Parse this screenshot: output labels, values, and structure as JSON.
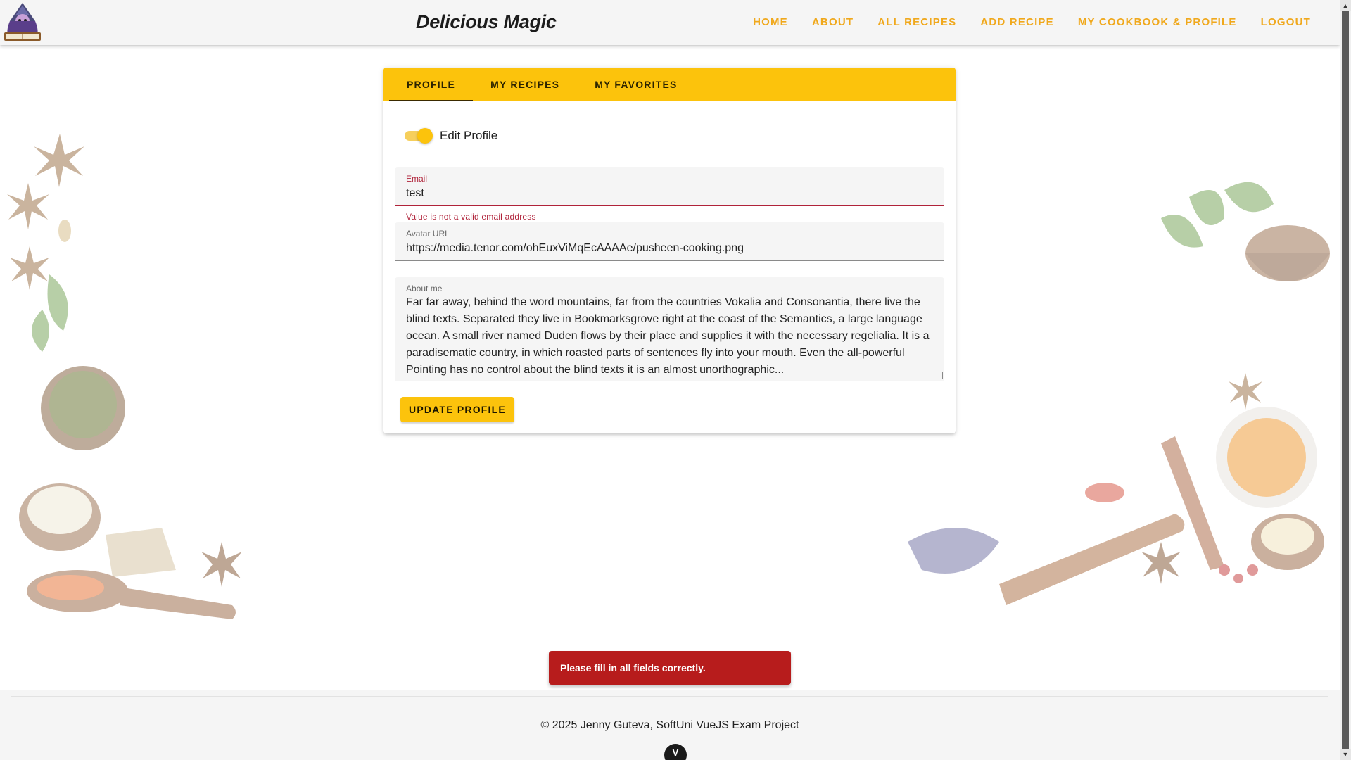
{
  "header": {
    "title": "Delicious Magic",
    "logo_icon": "wizard-cookbook-logo-icon",
    "nav": [
      {
        "label": "HOME"
      },
      {
        "label": "ABOUT"
      },
      {
        "label": "ALL RECIPES"
      },
      {
        "label": "ADD RECIPE"
      },
      {
        "label": "MY COOKBOOK & PROFILE"
      },
      {
        "label": "LOGOUT"
      }
    ],
    "nav_color": "#f0a81c"
  },
  "tabs": [
    {
      "label": "PROFILE",
      "active": true
    },
    {
      "label": "MY RECIPES",
      "active": false
    },
    {
      "label": "MY FAVORITES",
      "active": false
    }
  ],
  "accent_color": "#fcc30c",
  "profile": {
    "edit_toggle_label": "Edit Profile",
    "edit_toggle_on": true,
    "email": {
      "label": "Email",
      "value": "test",
      "error": "Value is not a valid email address"
    },
    "avatar": {
      "label": "Avatar URL",
      "value": "https://media.tenor.com/ohEuxViMqEcAAAAe/pusheen-cooking.png"
    },
    "about": {
      "label": "About me",
      "value": "Far far away, behind the word mountains, far from the countries Vokalia and Consonantia, there live the blind texts. Separated they live in Bookmarksgrove right at the coast of the Semantics, a large language ocean. A small river named Duden flows by their place and supplies it with the necessary regelialia. It is a paradisematic country, in which roasted parts of sentences fly into your mouth. Even the all-powerful Pointing has no control about the blind texts it is an almost unorthographic..."
    },
    "update_button": "UPDATE PROFILE"
  },
  "snackbar": {
    "message": "Please fill in all fields correctly.",
    "color": "#b71c1c"
  },
  "footer": {
    "text": "© 2025 Jenny Guteva, SoftUni VueJS Exam Project",
    "icon": "vue-devtools-icon"
  }
}
